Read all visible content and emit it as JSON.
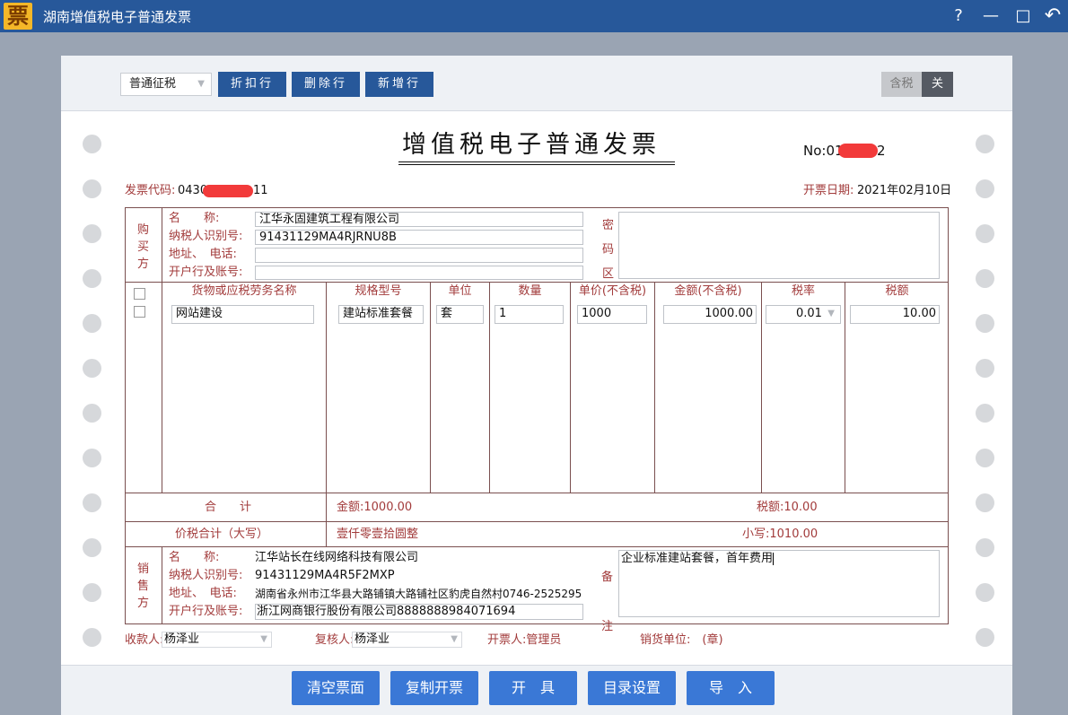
{
  "app": {
    "logo_char": "票",
    "title": "湖南增值税电子普通发票",
    "help_icon": "?",
    "minimize_icon": "—",
    "maximize_icon": "□",
    "back_icon": "↶"
  },
  "toolbar": {
    "tax_type": "普通征税",
    "btn_discount": "折扣行",
    "btn_delete": "删除行",
    "btn_add": "新增行",
    "tax_incl_label": "含税",
    "tax_incl_toggle": "关"
  },
  "invoice": {
    "title": "增值税电子普通发票",
    "no_label": "No:01",
    "no_tail": "2",
    "code_label": "发票代码:",
    "code_value": "0430",
    "code_tail": "11",
    "date_label": "开票日期:",
    "date_value": "2021年02月10日",
    "buyer": {
      "section_label": [
        "购",
        "买",
        "方"
      ],
      "name_label": "名　　称:",
      "name_value": "江华永固建筑工程有限公司",
      "taxid_label": "纳税人识别号:",
      "taxid_value": "91431129MA4RJRNU8B",
      "addr_label": "地址、　电话:",
      "addr_value": "",
      "bank_label": "开户行及账号:",
      "bank_value": ""
    },
    "cipher_label": [
      "密",
      "码",
      "区"
    ],
    "items_header": {
      "name": "货物或应税劳务名称",
      "spec": "规格型号",
      "unit": "单位",
      "qty": "数量",
      "price": "单价(不含税)",
      "amount": "金额(不含税)",
      "rate": "税率",
      "tax": "税额"
    },
    "items": [
      {
        "name": "网站建设",
        "spec": "建站标准套餐",
        "unit": "套",
        "qty": "1",
        "price": "1000",
        "amount": "1000.00",
        "rate": "0.01",
        "tax": "10.00"
      }
    ],
    "total_label": "合　　计",
    "total_amount": "金额:1000.00",
    "total_tax": "税额:10.00",
    "grand_label": "价税合计（大写）",
    "grand_upper": "壹仟零壹拾圆整",
    "grand_lower": "小写:1010.00",
    "seller": {
      "section_label": [
        "销",
        "售",
        "方"
      ],
      "name_label": "名　　称:",
      "name_value": "江华站长在线网络科技有限公司",
      "taxid_label": "纳税人识别号:",
      "taxid_value": "91431129MA4R5F2MXP",
      "addr_label": "地址、　电话:",
      "addr_value": "湖南省永州市江华县大路铺镇大路铺社区豹虎自然村0746-2525295",
      "bank_label": "开户行及账号:",
      "bank_value": "浙江网商银行股份有限公司8888888984071694"
    },
    "remark_label": [
      "备",
      "注"
    ],
    "remark_value": "企业标准建站套餐，首年费用",
    "payee_label": "收款人:",
    "payee_value": "杨泽业",
    "reviewer_label": "复核人:",
    "reviewer_value": "杨泽业",
    "issuer": "开票人:管理员",
    "seller_unit": "销货单位:　(章)"
  },
  "bottom": {
    "btn_clear": "清空票面",
    "btn_copy": "复制开票",
    "btn_issue": "开　具",
    "btn_catalog": "目录设置",
    "btn_import": "导　入"
  },
  "colors": {
    "titlebar": "#27589a",
    "toolbar_btn": "#27589a",
    "bottom_btn": "#3a78d6",
    "form_line": "#7a4f4f",
    "label_text": "#a23b3b",
    "redaction": "#f23a3a"
  }
}
